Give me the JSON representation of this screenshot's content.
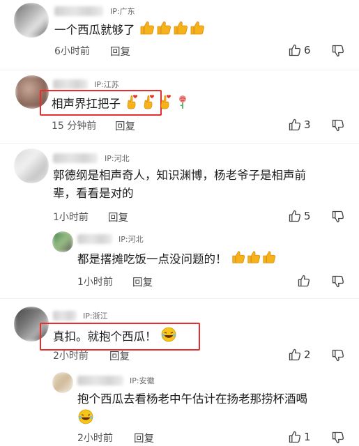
{
  "comments": [
    {
      "ip": "IP:广东",
      "text": "一个西瓜就够了",
      "time": "6小时前",
      "reply": "回复",
      "likes": "6",
      "emojis": [
        "thumbs-up",
        "thumbs-up",
        "thumbs-up",
        "thumbs-up"
      ]
    },
    {
      "ip": "IP:江苏",
      "text": "相声界扛把子",
      "time": "15 分钟前",
      "reply": "回复",
      "likes": "3",
      "emojis": [
        "finger-heart",
        "finger-heart",
        "finger-heart",
        "rose"
      ]
    },
    {
      "ip": "IP:河北",
      "text_line1": "郭德纲是相声奇人，知识渊博，杨老爷子是相声前",
      "text_line2": "辈，看看是对的",
      "time": "1小时前",
      "reply": "回复",
      "likes": "5"
    },
    {
      "ip": "IP:河北",
      "text": "都是撂摊吃饭一点没问题的！",
      "time": "1小时前",
      "reply": "回复",
      "likes": "",
      "emojis": [
        "thumbs-up",
        "thumbs-up",
        "thumbs-up"
      ]
    },
    {
      "ip": "IP:浙江",
      "text": "真扣。就抱个西瓜！",
      "time": "2小时前",
      "reply": "回复",
      "likes": "2",
      "emojis": [
        "laughing-tears"
      ]
    },
    {
      "ip": "IP:安徽",
      "text": "抱个西瓜去看杨老中午估计在扬老那捞杯酒喝",
      "time": "2小时前",
      "reply": "回复",
      "likes": "1",
      "emojis": [
        "laughing-tears"
      ]
    }
  ],
  "colors": {
    "highlight_box": "#e62e2e",
    "meta_gray": "#555555",
    "emoji_yellow": "#f5b21b"
  }
}
